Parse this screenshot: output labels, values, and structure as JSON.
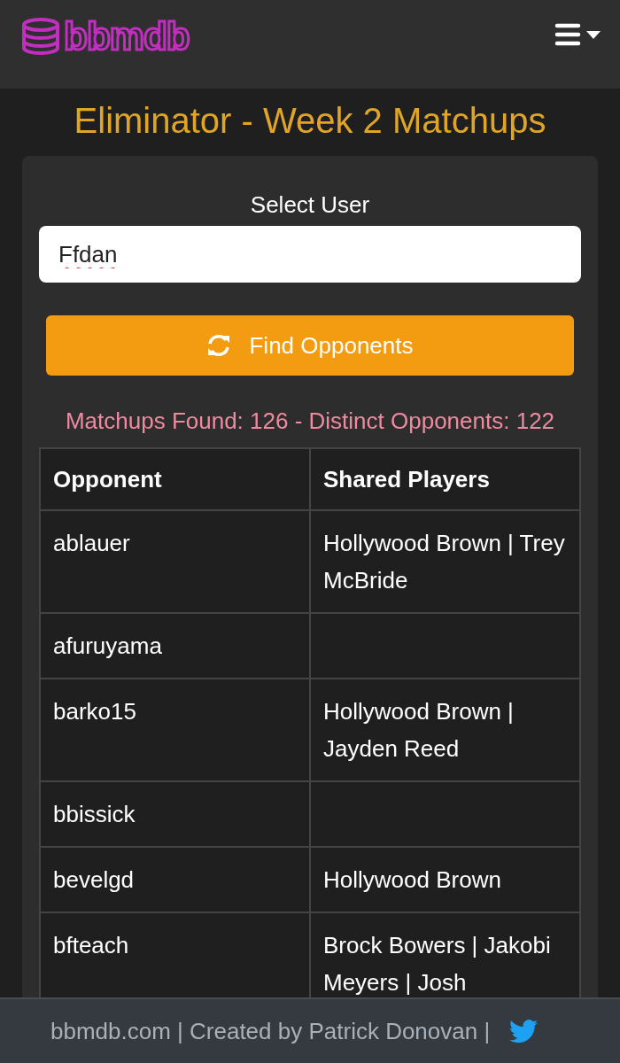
{
  "header": {
    "logo": "bbmdb"
  },
  "title": "Eliminator - Week 2 Matchups",
  "form": {
    "label": "Select User",
    "value": "Ffdan",
    "button": "Find Opponents"
  },
  "summary": "Matchups Found: 126 - Distinct Opponents: 122",
  "table": {
    "columns": [
      "Opponent",
      "Shared Players"
    ],
    "rows": [
      [
        "ablauer",
        "Hollywood Brown | Trey McBride"
      ],
      [
        "afuruyama",
        ""
      ],
      [
        "barko15",
        "Hollywood Brown | Jayden Reed"
      ],
      [
        "bbissick",
        ""
      ],
      [
        "bevelgd",
        "Hollywood Brown"
      ],
      [
        "bfteach",
        "Brock Bowers | Jakobi Meyers | Josh"
      ]
    ]
  },
  "footer": {
    "text": "bbmdb.com | Created by Patrick Donovan |"
  }
}
